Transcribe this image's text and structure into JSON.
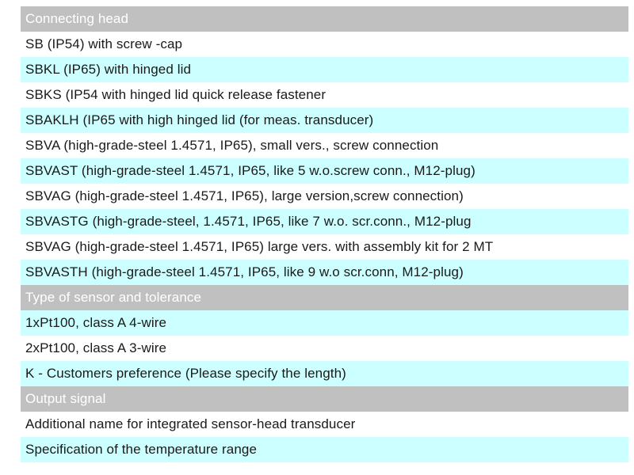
{
  "table": {
    "title": "Connecting head",
    "accent_colors": {
      "section_header_bg": "#c0c0c0",
      "section_header_text": "#ffffff",
      "row_alt_bg": "#ccffff",
      "row_bg": "#ffffff",
      "body_text": "#1a1a1a",
      "highlight_text": "#ff3b30"
    },
    "rows": [
      {
        "kind": "section",
        "zebra": "gray",
        "color": "white",
        "label": "Connecting head"
      },
      {
        "kind": "item",
        "zebra": "white",
        "color": "black",
        "label": "SB (IP54) with screw -cap"
      },
      {
        "kind": "item",
        "zebra": "cyan",
        "color": "black",
        "label": "SBKL (IP65) with hinged lid"
      },
      {
        "kind": "item",
        "zebra": "white",
        "color": "black",
        "label": "SBKS (IP54 with hinged lid quick release fastener"
      },
      {
        "kind": "item",
        "zebra": "cyan",
        "color": "black",
        "label": "SBAKLH (IP65 with high hinged lid (for meas. transducer)"
      },
      {
        "kind": "item",
        "zebra": "white",
        "color": "red",
        "label": "SBVA (high-grade-steel 1.4571, IP65), small vers., screw connection"
      },
      {
        "kind": "item",
        "zebra": "cyan",
        "color": "red",
        "label": "SBVAST (high-grade-steel 1.4571, IP65, like 5 w.o.screw conn., M12-plug)"
      },
      {
        "kind": "item",
        "zebra": "white",
        "color": "black",
        "label": "SBVAG (high-grade-steel 1.4571, IP65), large version,screw connection)"
      },
      {
        "kind": "item",
        "zebra": "cyan",
        "color": "black",
        "label": "SBVASTG (high-grade-steel, 1.4571, IP65, like 7 w.o. scr.conn.,  M12-plug"
      },
      {
        "kind": "item",
        "zebra": "white",
        "color": "black",
        "label": "SBVAG (high-grade-steel 1.4571, IP65) large vers. with assembly kit for 2 MT"
      },
      {
        "kind": "item",
        "zebra": "cyan",
        "color": "black",
        "label": "SBVASTH (high-grade-steel 1.4571, IP65, like 9 w.o scr.conn, M12-plug)"
      },
      {
        "kind": "section",
        "zebra": "gray",
        "color": "white",
        "label": "Type of sensor and tolerance"
      },
      {
        "kind": "item",
        "zebra": "cyan",
        "color": "black",
        "label": "1xPt100, class A 4-wire"
      },
      {
        "kind": "item",
        "zebra": "white",
        "color": "black",
        "label": "2xPt100, class A 3-wire"
      },
      {
        "kind": "item",
        "zebra": "cyan",
        "color": "black",
        "label": "K  -  Customers preference (Please specify the length)"
      },
      {
        "kind": "section",
        "zebra": "gray",
        "color": "white",
        "label": "Output signal"
      },
      {
        "kind": "item",
        "zebra": "white",
        "color": "red",
        "indent": true,
        "label": "Additional name for integrated sensor-head transducer"
      },
      {
        "kind": "item",
        "zebra": "cyan",
        "color": "black",
        "label": "Specification of the temperature range"
      }
    ]
  }
}
